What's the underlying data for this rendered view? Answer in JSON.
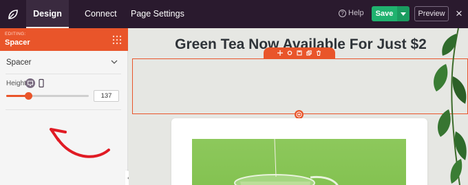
{
  "topbar": {
    "tabs": [
      {
        "label": "Design",
        "active": true
      },
      {
        "label": "Connect",
        "active": false
      },
      {
        "label": "Page Settings",
        "active": false
      }
    ],
    "help_label": "Help",
    "save_label": "Save",
    "preview_label": "Preview",
    "close_icon": "×"
  },
  "sidebar": {
    "editing_label": "EDITING:",
    "editing_name": "Spacer",
    "section_title": "Spacer",
    "height_label": "Height",
    "height_value": "137",
    "slider_fraction": 0.27,
    "accent_color": "#e9552a"
  },
  "canvas": {
    "headline": "Green Tea Now Available For Just $2",
    "toolbar_icons": [
      "move-icon",
      "settings-icon",
      "save-block-icon",
      "duplicate-icon",
      "delete-icon"
    ]
  },
  "colors": {
    "topbar_bg": "#2a1a2e",
    "save_green": "#20b26f",
    "canvas_bg": "#e6e7e3"
  }
}
